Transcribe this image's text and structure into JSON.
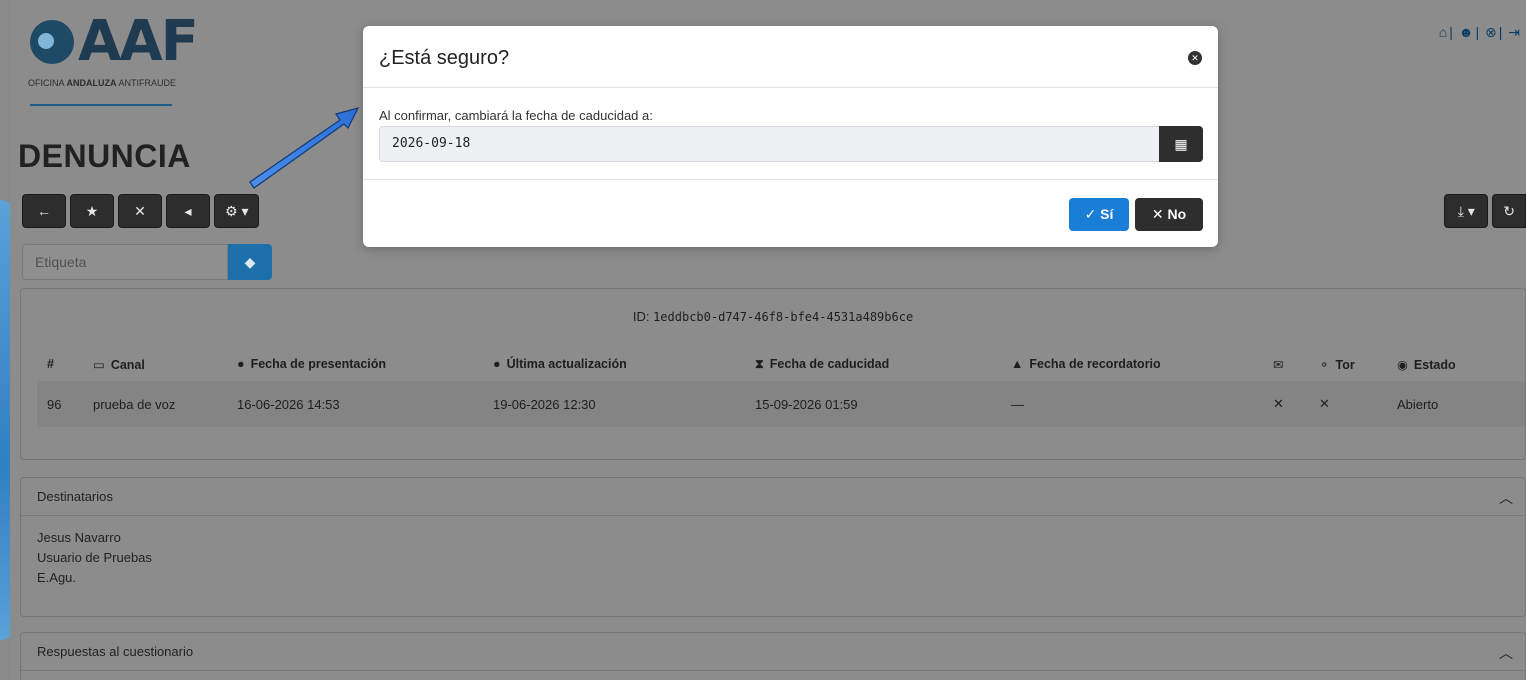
{
  "logo": {
    "letters": "AAF",
    "subtitle_pre": "OFICINA ",
    "subtitle_bold": "ANDALUZA",
    "subtitle_post": " ANTIFRAUDE"
  },
  "top_icons": [
    "home-icon",
    "user-icon",
    "help-icon",
    "logout-icon"
  ],
  "page_title": "DENUNCIA",
  "toolbar": {
    "back_icon": "←",
    "star_icon": "★",
    "mute_icon": "🔕",
    "volume_icon": "🔈",
    "settings_icon": "⚙ ▾",
    "download_icon": "⤓ ▾",
    "refresh_icon": "↻"
  },
  "tag": {
    "placeholder": "Etiqueta",
    "icon": "tag-icon"
  },
  "main_card": {
    "id_label": "ID:",
    "id_value": "1eddbcb0-d747-46f8-bfe4-4531a489b6ce",
    "columns": [
      "#",
      "Canal",
      "Fecha de presentación",
      "Última actualización",
      "Fecha de caducidad",
      "Fecha de recordatorio",
      "",
      "Tor",
      "Estado"
    ],
    "row": [
      "96",
      "prueba de voz",
      "16-06-2026 14:53",
      "19-06-2026 12:30",
      "15-09-2026 01:59",
      "—",
      "✕",
      "✕",
      "Abierto"
    ]
  },
  "destinatarios": {
    "title": "Destinatarios",
    "items": [
      "Jesus Navarro",
      "Usuario de Pruebas",
      "E.Agu."
    ]
  },
  "respuestas": {
    "title": "Respuestas al cuestionario"
  },
  "modal": {
    "title": "¿Está seguro?",
    "label": "Al confirmar, cambiará la fecha de caducidad a:",
    "date_value": "2026-09-18",
    "yes_label": "✓ Sí",
    "no_label": "✕ No"
  },
  "colors": {
    "primary": "#1b7ed6",
    "dark": "#2e2e2e",
    "overlay": "#8c8c8c",
    "arrow": "#2a6fd8"
  }
}
